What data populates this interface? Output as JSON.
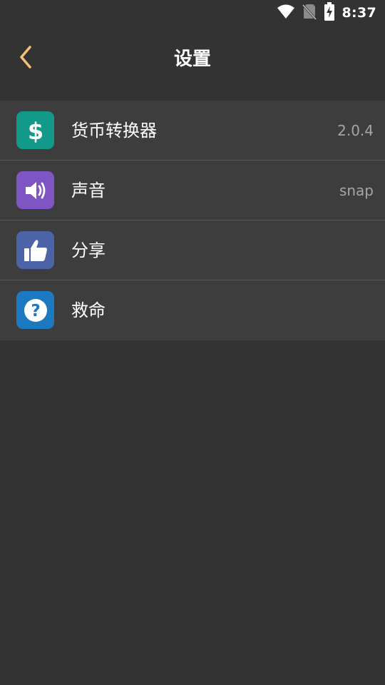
{
  "status_bar": {
    "time": "8:37",
    "icons": [
      "wifi-icon",
      "no-sim-icon",
      "battery-charging-icon"
    ]
  },
  "header": {
    "title": "设置",
    "back_icon": "chevron-left-icon",
    "accent_color": "#f2c27a"
  },
  "settings": {
    "items": [
      {
        "label": "货币转换器",
        "value": "2.0.4",
        "icon": "dollar-icon",
        "icon_color": "#12998a"
      },
      {
        "label": "声音",
        "value": "snap",
        "icon": "speaker-icon",
        "icon_color": "#7f55c4"
      },
      {
        "label": "分享",
        "value": "",
        "icon": "thumbs-up-icon",
        "icon_color": "#4c63a8"
      },
      {
        "label": "救命",
        "value": "",
        "icon": "help-icon",
        "icon_color": "#1c79c0"
      }
    ]
  },
  "colors": {
    "background": "#333333",
    "list_background": "#3d3d3d",
    "divider": "#555555",
    "secondary_text": "#a5a5a5"
  }
}
